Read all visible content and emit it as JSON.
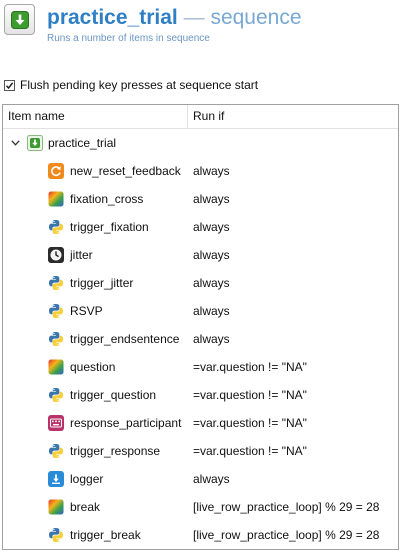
{
  "header": {
    "item_name": "practice_trial",
    "separator": "—",
    "item_type": "sequence",
    "description": "Runs a number of items in sequence"
  },
  "flush": {
    "label": "Flush pending key presses at sequence start",
    "checked": true
  },
  "columns": {
    "item_name": "Item name",
    "run_if": "Run if"
  },
  "root": {
    "name": "practice_trial",
    "expanded": true,
    "icon": "sequence-icon"
  },
  "children": [
    {
      "name": "new_reset_feedback",
      "run_if": "always",
      "icon": "reset-feedback-icon"
    },
    {
      "name": "fixation_cross",
      "run_if": "always",
      "icon": "sketchpad-icon"
    },
    {
      "name": "trigger_fixation",
      "run_if": "always",
      "icon": "python-icon"
    },
    {
      "name": "jitter",
      "run_if": "always",
      "icon": "clock-icon"
    },
    {
      "name": "trigger_jitter",
      "run_if": "always",
      "icon": "python-icon"
    },
    {
      "name": "RSVP",
      "run_if": "always",
      "icon": "python-icon"
    },
    {
      "name": "trigger_endsentence",
      "run_if": "always",
      "icon": "python-icon"
    },
    {
      "name": "question",
      "run_if": "=var.question != \"NA\"",
      "icon": "sketchpad-icon"
    },
    {
      "name": "trigger_question",
      "run_if": "=var.question != \"NA\"",
      "icon": "python-icon"
    },
    {
      "name": "response_participant",
      "run_if": "=var.question != \"NA\"",
      "icon": "keyboard-response-icon"
    },
    {
      "name": "trigger_response",
      "run_if": "=var.question != \"NA\"",
      "icon": "python-icon"
    },
    {
      "name": "logger",
      "run_if": "always",
      "icon": "logger-icon"
    },
    {
      "name": "break",
      "run_if": "[live_row_practice_loop] % 29 = 28",
      "icon": "sketchpad-icon"
    },
    {
      "name": "trigger_break",
      "run_if": "[live_row_practice_loop] % 29 = 28",
      "icon": "python-icon"
    }
  ]
}
